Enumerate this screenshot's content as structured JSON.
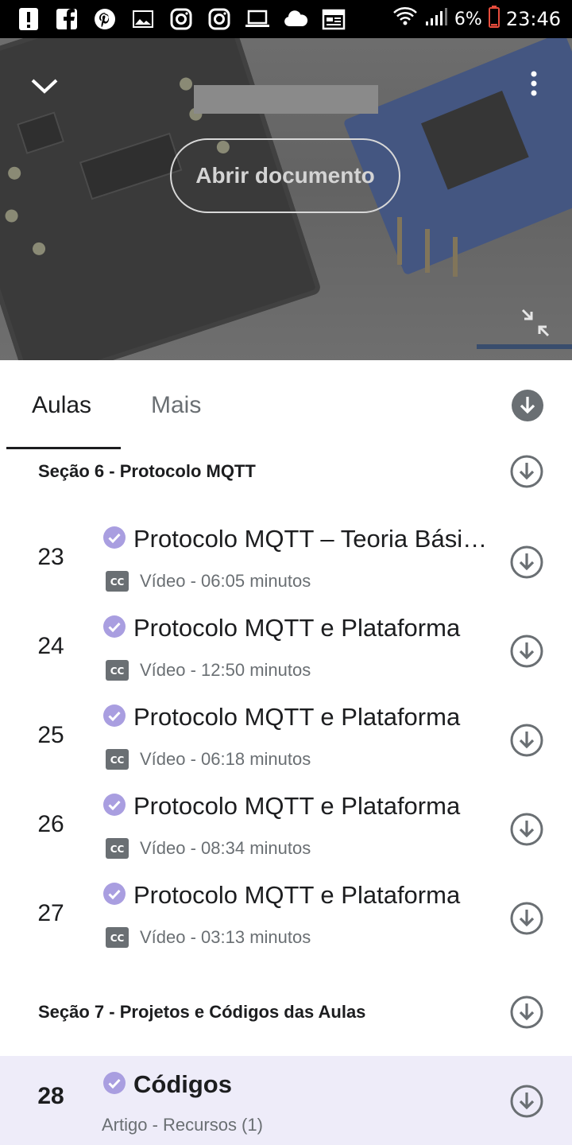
{
  "status_bar": {
    "icons": [
      "alert-icon",
      "facebook-icon",
      "pinterest-icon",
      "gallery-icon",
      "instagram-icon",
      "instagram-icon",
      "laptop-icon",
      "cloud-icon",
      "calendar-icon"
    ],
    "battery": "6%",
    "time": "23:46"
  },
  "player": {
    "open_document_label": "Abrir documento"
  },
  "tabs": [
    {
      "label": "Aulas",
      "selected": true
    },
    {
      "label": "Mais",
      "selected": false
    }
  ],
  "sections": [
    {
      "title": "Seção 6 - Protocolo MQTT",
      "lectures": [
        {
          "number": "23",
          "title": "Protocolo MQTT – Teoria Básica",
          "meta": "Vídeo - 06:05 minutos",
          "completed": true
        },
        {
          "number": "24",
          "title": "Protocolo MQTT e Plataforma",
          "meta": "Vídeo - 12:50 minutos",
          "completed": true
        },
        {
          "number": "25",
          "title": "Protocolo MQTT e Plataforma",
          "meta": "Vídeo - 06:18 minutos",
          "completed": true
        },
        {
          "number": "26",
          "title": "Protocolo MQTT e Plataforma",
          "meta": "Vídeo - 08:34 minutos",
          "completed": true
        },
        {
          "number": "27",
          "title": "Protocolo MQTT e Plataforma",
          "meta": "Vídeo - 03:13 minutos",
          "completed": true
        }
      ]
    },
    {
      "title": "Seção 7 - Projetos e Códigos das Aulas",
      "lectures": [
        {
          "number": "28",
          "title": "Códigos",
          "meta": "Artigo - Recursos (1)",
          "completed": true,
          "current": true
        }
      ]
    }
  ],
  "colors": {
    "accent_purple": "#a99ee0",
    "active_row_bg": "#eeecf9",
    "icon_gray": "#6a6f73",
    "text_dark": "#1c1d1f"
  }
}
